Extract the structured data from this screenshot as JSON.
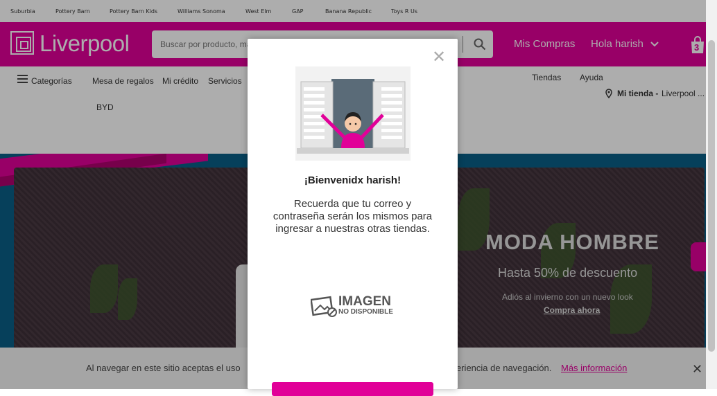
{
  "topbar": {
    "links": [
      "Suburbia",
      "Pottery Barn",
      "Pottery Barn Kids",
      "Williams Sonoma",
      "West Elm",
      "GAP",
      "Banana Republic",
      "Toys R Us"
    ]
  },
  "header": {
    "logo": "Liverpool",
    "search_placeholder": "Buscar por producto, marca y más...",
    "mis_compras": "Mis Compras",
    "greeting": "Hola harish",
    "bag_count": "3"
  },
  "nav": {
    "categorias": "Categorías",
    "items": [
      "Mesa de regalos",
      "Mi crédito",
      "Servicios"
    ],
    "byd": "BYD",
    "tiendas": "Tiendas",
    "ayuda": "Ayuda",
    "mi_tienda_label": "Mi tienda -",
    "mi_tienda_value": "Liverpool ..."
  },
  "hero": {
    "title": "MODA HOMBRE",
    "subtitle": "Hasta 50% de descuento",
    "text": "Adiós al invierno con un nuevo look",
    "link": "Compra ahora"
  },
  "cookie": {
    "text": "Al navegar en este sitio aceptas el uso de cookies para agilizar tu experiencia de navegación.",
    "text_left": "Al navegar en este sitio aceptas el uso",
    "text_right": "eriencia de navegación.",
    "more": "Más información"
  },
  "modal": {
    "title": "¡Bienvenidx harish!",
    "text": "Recuerda que tu correo y contraseña serán los mismos para ingresar a nuestras otras tiendas.",
    "noimg_title": "IMAGEN",
    "noimg_sub": "NO DISPONIBLE"
  },
  "colors": {
    "brand": "#e10098"
  }
}
